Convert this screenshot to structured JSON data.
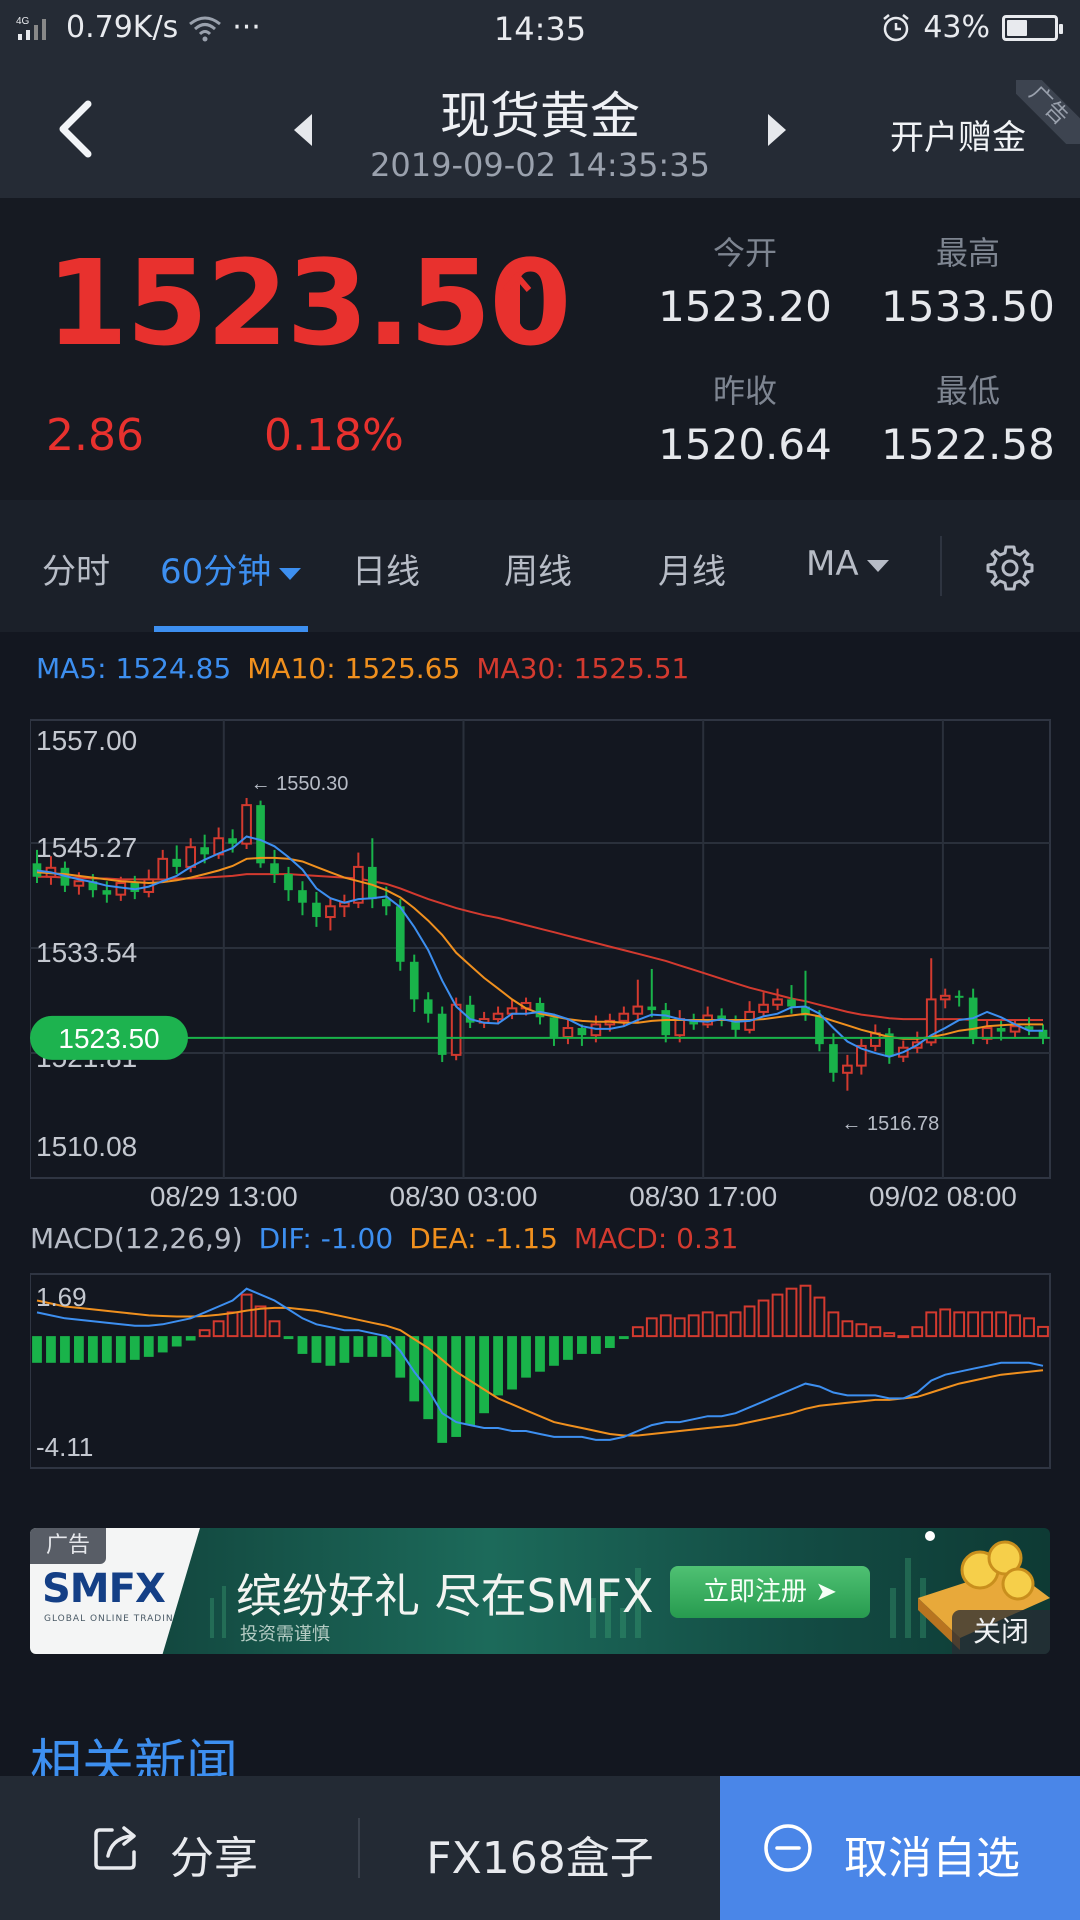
{
  "status_bar": {
    "network": "4G",
    "speed": "0.79K/s",
    "more": "···",
    "time": "14:35",
    "battery": "43%",
    "battery_level": 0.43
  },
  "header": {
    "title": "现货黄金",
    "timestamp": "2019-09-02 14:35:35",
    "action": "开户赠金",
    "ad_ribbon": "广告"
  },
  "quote": {
    "price": "1523.50",
    "change": "2.86",
    "change_pct": "0.18%",
    "stats": [
      {
        "label": "今开",
        "value": "1523.20"
      },
      {
        "label": "最高",
        "value": "1533.50"
      },
      {
        "label": "昨收",
        "value": "1520.64"
      },
      {
        "label": "最低",
        "value": "1522.58"
      }
    ],
    "up_color": "#e8312e"
  },
  "tabs": [
    {
      "label": "分时"
    },
    {
      "label": "60分钟"
    },
    {
      "label": "日线"
    },
    {
      "label": "周线"
    },
    {
      "label": "月线"
    },
    {
      "label": "MA"
    }
  ],
  "ma_legend": {
    "ma5": "MA5: 1524.85",
    "ma10": "MA10: 1525.65",
    "ma30": "MA30: 1525.51",
    "ma5_color": "#3d8ff0",
    "ma10_color": "#f0901e",
    "ma30_color": "#d33a2f"
  },
  "chart_data": [
    {
      "type": "candlestick",
      "ylim": [
        1510.08,
        1557.0
      ],
      "y_ticks": [
        "1557.00",
        "1545.27",
        "1533.54",
        "1521.81",
        "1510.08"
      ],
      "x_ticks": [
        "08/29 13:00",
        "08/30 03:00",
        "08/30 17:00",
        "09/02 08:00"
      ],
      "annotations": {
        "high": "← 1550.30",
        "low": "← 1516.78"
      },
      "current_price": "1523.50",
      "current_value": 1523.5,
      "candles": [
        [
          1543.0,
          1541.5,
          1544.5,
          1540.8
        ],
        [
          1541.5,
          1542.5,
          1543.8,
          1540.6
        ],
        [
          1542.5,
          1540.5,
          1543.2,
          1539.8
        ],
        [
          1540.5,
          1541.0,
          1542.0,
          1539.5
        ],
        [
          1541.0,
          1540.0,
          1541.8,
          1539.2
        ],
        [
          1540.0,
          1539.5,
          1541.0,
          1538.6
        ],
        [
          1539.5,
          1540.8,
          1541.5,
          1538.8
        ],
        [
          1540.8,
          1539.8,
          1541.6,
          1539.0
        ],
        [
          1539.8,
          1541.2,
          1542.3,
          1539.2
        ],
        [
          1541.2,
          1543.5,
          1544.5,
          1540.8
        ],
        [
          1543.5,
          1542.6,
          1545.0,
          1541.8
        ],
        [
          1542.6,
          1544.8,
          1545.8,
          1542.0
        ],
        [
          1544.8,
          1544.0,
          1546.2,
          1543.0
        ],
        [
          1544.0,
          1545.8,
          1547.0,
          1543.5
        ],
        [
          1545.8,
          1545.2,
          1546.8,
          1544.2
        ],
        [
          1545.2,
          1549.5,
          1550.3,
          1544.6
        ],
        [
          1549.5,
          1543.0,
          1550.0,
          1542.5
        ],
        [
          1543.0,
          1541.8,
          1544.5,
          1540.8
        ],
        [
          1541.8,
          1540.0,
          1542.6,
          1538.8
        ],
        [
          1540.0,
          1538.6,
          1541.0,
          1537.2
        ],
        [
          1538.6,
          1537.0,
          1539.8,
          1535.9
        ],
        [
          1537.0,
          1538.2,
          1539.2,
          1535.5
        ],
        [
          1538.2,
          1538.6,
          1539.5,
          1537.0
        ],
        [
          1538.6,
          1542.6,
          1544.2,
          1538.0
        ],
        [
          1542.6,
          1539.0,
          1545.8,
          1538.0
        ],
        [
          1539.0,
          1538.2,
          1540.4,
          1537.2
        ],
        [
          1538.2,
          1532.0,
          1539.0,
          1531.0
        ],
        [
          1532.0,
          1527.8,
          1532.8,
          1526.4
        ],
        [
          1527.8,
          1526.2,
          1528.6,
          1525.2
        ],
        [
          1526.2,
          1521.6,
          1527.0,
          1520.8
        ],
        [
          1521.6,
          1527.2,
          1528.0,
          1521.0
        ],
        [
          1527.2,
          1525.2,
          1528.2,
          1524.6
        ],
        [
          1525.2,
          1525.6,
          1526.4,
          1524.6
        ],
        [
          1525.6,
          1526.2,
          1527.0,
          1525.0
        ],
        [
          1526.2,
          1526.8,
          1527.8,
          1525.6
        ],
        [
          1526.8,
          1527.4,
          1528.0,
          1526.0
        ],
        [
          1527.4,
          1525.8,
          1528.0,
          1525.0
        ],
        [
          1525.8,
          1523.6,
          1526.2,
          1522.6
        ],
        [
          1523.6,
          1524.6,
          1525.6,
          1522.8
        ],
        [
          1524.6,
          1523.8,
          1525.0,
          1522.6
        ],
        [
          1523.8,
          1525.0,
          1526.0,
          1523.0
        ],
        [
          1525.0,
          1525.4,
          1526.2,
          1524.2
        ],
        [
          1525.4,
          1526.2,
          1527.0,
          1524.8
        ],
        [
          1526.2,
          1527.0,
          1530.0,
          1525.2
        ],
        [
          1527.0,
          1526.6,
          1531.2,
          1525.8
        ],
        [
          1526.6,
          1523.8,
          1527.4,
          1523.0
        ],
        [
          1523.8,
          1525.6,
          1526.6,
          1523.0
        ],
        [
          1525.6,
          1525.0,
          1526.2,
          1524.4
        ],
        [
          1525.0,
          1526.0,
          1527.0,
          1524.6
        ],
        [
          1526.0,
          1525.4,
          1526.8,
          1524.8
        ],
        [
          1525.4,
          1524.4,
          1526.0,
          1523.6
        ],
        [
          1524.4,
          1526.4,
          1527.6,
          1524.0
        ],
        [
          1526.4,
          1527.2,
          1528.6,
          1525.8
        ],
        [
          1527.2,
          1527.8,
          1529.0,
          1526.6
        ],
        [
          1527.8,
          1527.0,
          1529.4,
          1526.2
        ],
        [
          1527.0,
          1526.0,
          1531.0,
          1525.4
        ],
        [
          1526.0,
          1522.8,
          1526.6,
          1522.0
        ],
        [
          1522.8,
          1519.6,
          1524.0,
          1518.6
        ],
        [
          1519.6,
          1520.4,
          1521.6,
          1517.6
        ],
        [
          1520.4,
          1522.6,
          1523.4,
          1519.4
        ],
        [
          1522.6,
          1524.0,
          1525.0,
          1522.0
        ],
        [
          1524.0,
          1521.4,
          1524.6,
          1520.6
        ],
        [
          1521.4,
          1522.4,
          1523.2,
          1520.8
        ],
        [
          1522.4,
          1523.0,
          1524.2,
          1521.8
        ],
        [
          1523.0,
          1527.8,
          1532.4,
          1522.6
        ],
        [
          1527.8,
          1528.2,
          1529.0,
          1526.8
        ],
        [
          1528.2,
          1528.0,
          1528.8,
          1527.0
        ],
        [
          1528.0,
          1523.4,
          1529.0,
          1522.8
        ],
        [
          1523.4,
          1524.6,
          1525.6,
          1522.8
        ],
        [
          1524.6,
          1524.2,
          1525.4,
          1523.2
        ],
        [
          1524.2,
          1524.8,
          1525.6,
          1523.6
        ],
        [
          1524.8,
          1524.4,
          1525.8,
          1523.8
        ],
        [
          1524.4,
          1523.6,
          1525.0,
          1522.8
        ]
      ],
      "ma5": [
        1542.2,
        1542.0,
        1541.6,
        1541.2,
        1540.9,
        1540.5,
        1540.3,
        1540.1,
        1540.4,
        1541.0,
        1541.6,
        1542.6,
        1543.4,
        1544.1,
        1544.7,
        1546.0,
        1545.6,
        1544.9,
        1543.7,
        1542.3,
        1540.2,
        1539.1,
        1538.6,
        1539.0,
        1539.1,
        1539.3,
        1538.1,
        1535.9,
        1533.3,
        1529.9,
        1527.0,
        1525.6,
        1525.2,
        1525.1,
        1526.2,
        1526.2,
        1526.4,
        1526.1,
        1525.6,
        1524.8,
        1524.5,
        1524.5,
        1524.8,
        1525.5,
        1526.1,
        1526.0,
        1525.6,
        1525.4,
        1525.3,
        1525.6,
        1525.3,
        1525.4,
        1525.9,
        1526.2,
        1526.9,
        1527.0,
        1526.2,
        1524.6,
        1523.1,
        1522.3,
        1521.8,
        1521.4,
        1521.9,
        1522.7,
        1523.8,
        1524.6,
        1525.5,
        1525.7,
        1526.4,
        1525.8,
        1525.0,
        1524.3,
        1524.3
      ],
      "ma10": [
        1542.0,
        1541.9,
        1541.8,
        1541.6,
        1541.4,
        1541.2,
        1541.0,
        1540.9,
        1540.8,
        1540.9,
        1541.1,
        1541.4,
        1541.8,
        1542.2,
        1542.7,
        1543.5,
        1543.6,
        1543.6,
        1543.5,
        1543.2,
        1542.6,
        1542.0,
        1541.4,
        1541.0,
        1540.6,
        1540.0,
        1539.2,
        1538.0,
        1536.6,
        1535.0,
        1533.0,
        1531.6,
        1530.2,
        1529.0,
        1527.8,
        1526.8,
        1526.2,
        1525.9,
        1525.6,
        1525.4,
        1525.3,
        1525.3,
        1525.2,
        1525.2,
        1525.4,
        1525.5,
        1525.5,
        1525.5,
        1525.5,
        1525.5,
        1525.5,
        1525.5,
        1525.6,
        1525.8,
        1526.0,
        1526.2,
        1525.9,
        1525.4,
        1524.9,
        1524.4,
        1524.0,
        1523.6,
        1523.4,
        1523.4,
        1523.6,
        1523.9,
        1524.3,
        1524.5,
        1524.8,
        1524.9,
        1525.0,
        1525.0,
        1525.0
      ],
      "ma30": [
        1541.5,
        1541.5,
        1541.4,
        1541.4,
        1541.3,
        1541.3,
        1541.2,
        1541.2,
        1541.2,
        1541.2,
        1541.3,
        1541.3,
        1541.4,
        1541.5,
        1541.6,
        1541.8,
        1541.8,
        1541.8,
        1541.8,
        1541.7,
        1541.6,
        1541.5,
        1541.4,
        1541.3,
        1541.0,
        1540.7,
        1540.2,
        1539.6,
        1539.0,
        1538.5,
        1538.0,
        1537.6,
        1537.2,
        1536.9,
        1536.5,
        1536.1,
        1535.7,
        1535.3,
        1534.9,
        1534.5,
        1534.1,
        1533.7,
        1533.3,
        1532.9,
        1532.5,
        1532.1,
        1531.6,
        1531.1,
        1530.6,
        1530.1,
        1529.6,
        1529.1,
        1528.7,
        1528.3,
        1527.9,
        1527.6,
        1527.2,
        1526.8,
        1526.4,
        1526.1,
        1525.9,
        1525.7,
        1525.6,
        1525.6,
        1525.6,
        1525.6,
        1525.6,
        1525.5,
        1525.5,
        1525.5,
        1525.5,
        1525.5,
        1525.5
      ]
    },
    {
      "type": "macd",
      "label": "MACD(12,26,9)",
      "dif_label": "DIF: -1.00",
      "dea_label": "DEA: -1.15",
      "macd_label": "MACD: 0.31",
      "ylim": [
        -4.11,
        1.69
      ],
      "y_ticks": [
        "1.69",
        "-4.11"
      ],
      "dif": [
        0.8,
        0.7,
        0.6,
        0.55,
        0.5,
        0.45,
        0.4,
        0.35,
        0.35,
        0.4,
        0.5,
        0.6,
        0.8,
        1.0,
        1.2,
        1.6,
        1.4,
        1.2,
        0.9,
        0.6,
        0.4,
        0.3,
        0.2,
        0.2,
        0.1,
        0.0,
        -0.5,
        -1.2,
        -1.8,
        -2.6,
        -2.9,
        -3.0,
        -3.1,
        -3.1,
        -3.2,
        -3.2,
        -3.3,
        -3.4,
        -3.4,
        -3.4,
        -3.5,
        -3.5,
        -3.4,
        -3.2,
        -3.0,
        -2.9,
        -2.9,
        -2.8,
        -2.7,
        -2.7,
        -2.6,
        -2.4,
        -2.2,
        -2.0,
        -1.8,
        -1.6,
        -1.7,
        -1.9,
        -2.0,
        -2.0,
        -2.0,
        -2.1,
        -2.1,
        -1.9,
        -1.5,
        -1.3,
        -1.2,
        -1.1,
        -1.0,
        -0.9,
        -0.9,
        -0.9,
        -1.0
      ],
      "dea": [
        1.2,
        1.1,
        1.0,
        0.95,
        0.9,
        0.85,
        0.8,
        0.75,
        0.7,
        0.68,
        0.66,
        0.66,
        0.68,
        0.72,
        0.78,
        0.86,
        0.92,
        0.95,
        0.95,
        0.9,
        0.85,
        0.75,
        0.65,
        0.55,
        0.45,
        0.35,
        0.2,
        -0.1,
        -0.4,
        -0.8,
        -1.2,
        -1.5,
        -1.8,
        -2.1,
        -2.3,
        -2.5,
        -2.7,
        -2.9,
        -3.0,
        -3.1,
        -3.2,
        -3.3,
        -3.35,
        -3.35,
        -3.3,
        -3.25,
        -3.2,
        -3.15,
        -3.1,
        -3.05,
        -3.0,
        -2.9,
        -2.8,
        -2.7,
        -2.6,
        -2.45,
        -2.35,
        -2.3,
        -2.25,
        -2.2,
        -2.15,
        -2.15,
        -2.1,
        -2.05,
        -1.9,
        -1.75,
        -1.6,
        -1.5,
        -1.4,
        -1.3,
        -1.25,
        -1.2,
        -1.15
      ],
      "hist": [
        -0.9,
        -0.9,
        -0.9,
        -0.9,
        -0.9,
        -0.9,
        -0.9,
        -0.8,
        -0.7,
        -0.55,
        -0.35,
        -0.15,
        0.2,
        0.5,
        0.8,
        1.4,
        1.0,
        0.5,
        -0.1,
        -0.6,
        -0.9,
        -1.0,
        -0.9,
        -0.7,
        -0.7,
        -0.7,
        -1.4,
        -2.2,
        -2.8,
        -3.6,
        -3.4,
        -3.0,
        -2.6,
        -2.0,
        -1.8,
        -1.4,
        -1.2,
        -1.0,
        -0.8,
        -0.6,
        -0.6,
        -0.4,
        -0.1,
        0.3,
        0.6,
        0.7,
        0.6,
        0.7,
        0.8,
        0.7,
        0.8,
        1.0,
        1.2,
        1.4,
        1.6,
        1.7,
        1.3,
        0.8,
        0.5,
        0.4,
        0.3,
        0.1,
        0.0,
        0.3,
        0.8,
        0.9,
        0.8,
        0.8,
        0.8,
        0.8,
        0.7,
        0.6,
        0.31
      ]
    }
  ],
  "macd_colors": {
    "dif": "#3d8ff0",
    "dea": "#f0901e",
    "macd": "#d33a2f"
  },
  "ad": {
    "tag": "广告",
    "logo": "SMFX",
    "logo_sub": "GLOBAL ONLINE TRADING",
    "headline": "缤纷好礼 尽在SMFX",
    "note": "投资需谨慎",
    "cta": "立即注册 ➤",
    "close": "关闭"
  },
  "news": {
    "title": "相关新闻"
  },
  "bottom_bar": {
    "share": "分享",
    "box": "FX168盒子",
    "cancel": "取消自选"
  }
}
